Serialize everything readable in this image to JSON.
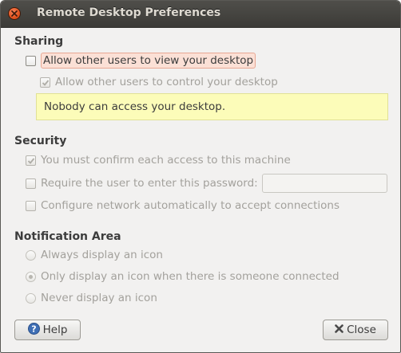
{
  "window": {
    "title": "Remote Desktop Preferences"
  },
  "sharing": {
    "heading": "Sharing",
    "allow_view": {
      "label": "Allow other users to view your desktop",
      "checked": false
    },
    "allow_control": {
      "label": "Allow other users to control your desktop",
      "checked": true,
      "enabled": false
    },
    "info_message": "Nobody can access your desktop."
  },
  "security": {
    "heading": "Security",
    "confirm_access": {
      "label": "You must confirm each access to this machine",
      "checked": true,
      "enabled": false
    },
    "require_password": {
      "label": "Require the user to enter this password:",
      "checked": false,
      "enabled": false
    },
    "password_value": "",
    "configure_network": {
      "label": "Configure network automatically to accept connections",
      "checked": false,
      "enabled": false
    }
  },
  "notification": {
    "heading": "Notification Area",
    "options": [
      {
        "label": "Always display an icon",
        "selected": false
      },
      {
        "label": "Only display an icon when there is someone connected",
        "selected": true
      },
      {
        "label": "Never display an icon",
        "selected": false
      }
    ]
  },
  "buttons": {
    "help_label": "Help",
    "help_icon": "help-icon",
    "close_label": "Close",
    "close_icon": "close-x-icon"
  },
  "colors": {
    "titlebar": "#3c3b37",
    "close_button": "#e2531f",
    "info_bg": "#fcfcb9",
    "focus_highlight": "#fbe0d6"
  }
}
